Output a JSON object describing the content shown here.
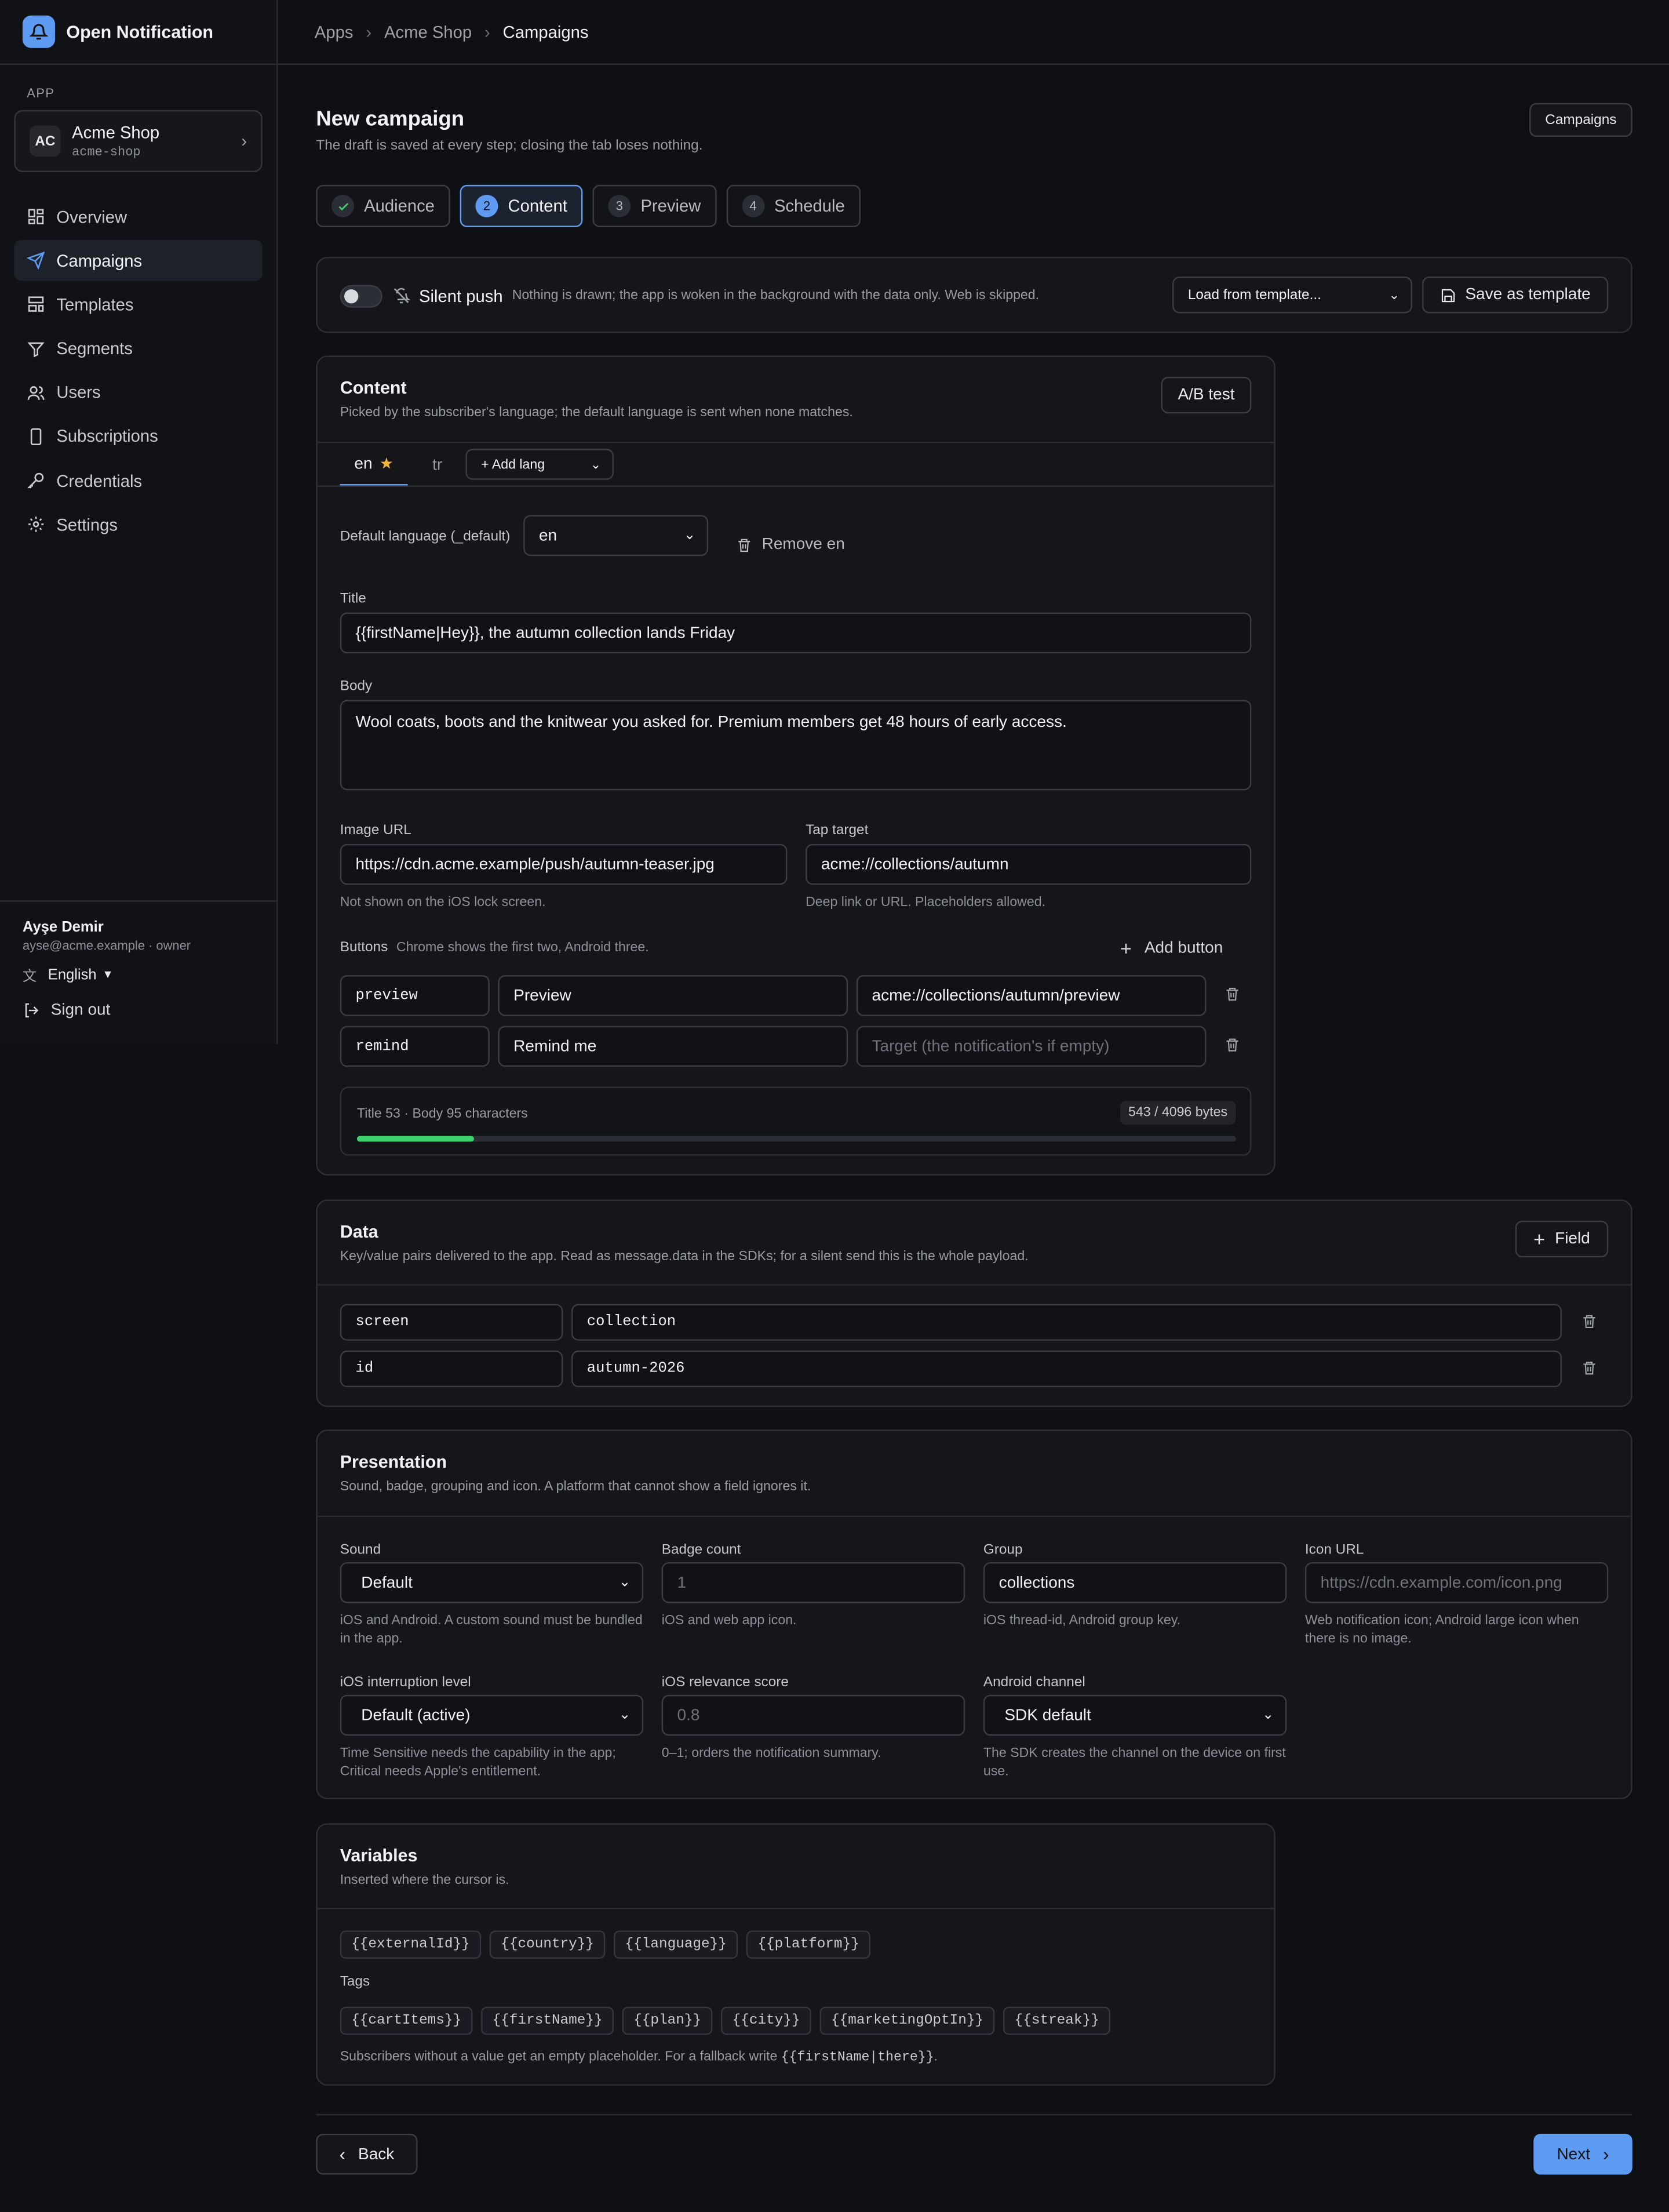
{
  "app": {
    "name": "Open Notification"
  },
  "sidebar": {
    "section_label": "APP",
    "app_switcher": {
      "avatar": "AC",
      "name": "Acme Shop",
      "slug": "acme-shop"
    },
    "nav": [
      {
        "label": "Overview",
        "icon": "dashboard-icon"
      },
      {
        "label": "Campaigns",
        "icon": "send-icon",
        "active": true
      },
      {
        "label": "Templates",
        "icon": "template-icon"
      },
      {
        "label": "Segments",
        "icon": "filter-icon"
      },
      {
        "label": "Users",
        "icon": "users-icon"
      },
      {
        "label": "Subscriptions",
        "icon": "device-icon"
      },
      {
        "label": "Credentials",
        "icon": "key-icon"
      },
      {
        "label": "Settings",
        "icon": "gear-icon"
      }
    ],
    "user": {
      "name": "Ayşe Demir",
      "meta": "ayse@acme.example · owner"
    },
    "language": "English",
    "sign_out": "Sign out"
  },
  "breadcrumb": [
    "Apps",
    "Acme Shop",
    "Campaigns"
  ],
  "page": {
    "title": "New campaign",
    "subtitle": "The draft is saved at every step; closing the tab loses nothing.",
    "campaigns_button": "Campaigns"
  },
  "steps": [
    {
      "num": "1",
      "label": "Audience",
      "done": true
    },
    {
      "num": "2",
      "label": "Content",
      "active": true
    },
    {
      "num": "3",
      "label": "Preview"
    },
    {
      "num": "4",
      "label": "Schedule"
    }
  ],
  "silent": {
    "label": "Silent push",
    "desc": "Nothing is drawn; the app is woken in the background with the data only. Web is skipped.",
    "enabled": false,
    "template_select": "Load from template...",
    "save_template": "Save as template"
  },
  "content": {
    "title": "Content",
    "subtitle": "Picked by the subscriber's language; the default language is sent when none matches.",
    "ab_button": "A/B test",
    "lang_tabs": [
      {
        "code": "en",
        "default": true
      },
      {
        "code": "tr"
      }
    ],
    "add_lang": "+ Add lang",
    "default_lang_label": "Default language (_default)",
    "default_lang_value": "en",
    "remove_label": "Remove en",
    "title_label": "Title",
    "title_value": "{{firstName|Hey}}, the autumn collection lands Friday",
    "body_label": "Body",
    "body_value": "Wool coats, boots and the knitwear you asked for. Premium members get 48 hours of early access.",
    "image_label": "Image URL",
    "image_value": "https://cdn.acme.example/push/autumn-teaser.jpg",
    "image_hint": "Not shown on the iOS lock screen.",
    "tap_label": "Tap target",
    "tap_value": "acme://collections/autumn",
    "tap_hint": "Deep link or URL. Placeholders allowed.",
    "buttons_label": "Buttons",
    "buttons_hint": "Chrome shows the first two, Android three.",
    "add_button": "Add button",
    "buttons": [
      {
        "id": "preview",
        "label": "Preview",
        "target": "acme://collections/autumn/preview",
        "target_placeholder": ""
      },
      {
        "id": "remind",
        "label": "Remind me",
        "target": "",
        "target_placeholder": "Target (the notification's if empty)"
      }
    ],
    "stats": "Title 53 · Body 95 characters",
    "bytes": "543 / 4096 bytes",
    "usage_fraction": 0.1326
  },
  "data_section": {
    "title": "Data",
    "subtitle": "Key/value pairs delivered to the app. Read as message.data in the SDKs; for a silent send this is the whole payload.",
    "add_field": "Field",
    "rows": [
      {
        "key": "screen",
        "value": "collection"
      },
      {
        "key": "id",
        "value": "autumn-2026"
      }
    ]
  },
  "presentation": {
    "title": "Presentation",
    "subtitle": "Sound, badge, grouping and icon. A platform that cannot show a field ignores it.",
    "sound": {
      "label": "Sound",
      "value": "Default",
      "hint": "iOS and Android. A custom sound must be bundled in the app."
    },
    "badge": {
      "label": "Badge count",
      "placeholder": "1",
      "hint": "iOS and web app icon."
    },
    "group": {
      "label": "Group",
      "value": "collections",
      "hint": "iOS thread-id, Android group key."
    },
    "icon_url": {
      "label": "Icon URL",
      "placeholder": "https://cdn.example.com/icon.png",
      "hint": "Web notification icon; Android large icon when there is no image."
    },
    "interruption": {
      "label": "iOS interruption level",
      "value": "Default (active)",
      "hint": "Time Sensitive needs the capability in the app; Critical needs Apple's entitlement."
    },
    "relevance": {
      "label": "iOS relevance score",
      "placeholder": "0.8",
      "hint": "0–1; orders the notification summary."
    },
    "channel": {
      "label": "Android channel",
      "value": "SDK default",
      "hint": "The SDK creates the channel on the device on first use."
    }
  },
  "variables": {
    "title": "Variables",
    "subtitle": "Inserted where the cursor is.",
    "builtins": [
      "{{externalId}}",
      "{{country}}",
      "{{language}}",
      "{{platform}}"
    ],
    "tags_label": "Tags",
    "tags": [
      "{{cartItems}}",
      "{{firstName}}",
      "{{plan}}",
      "{{city}}",
      "{{marketingOptIn}}",
      "{{streak}}"
    ],
    "note_prefix": "Subscribers without a value get an empty placeholder. For a fallback write ",
    "note_code": "{{firstName|there}}",
    "note_suffix": "."
  },
  "footer": {
    "back": "Back",
    "next": "Next"
  },
  "colors": {
    "accent": "#5d9cf2",
    "success": "#3ecf6e",
    "background": "#0f1013",
    "surface": "#15161a"
  }
}
